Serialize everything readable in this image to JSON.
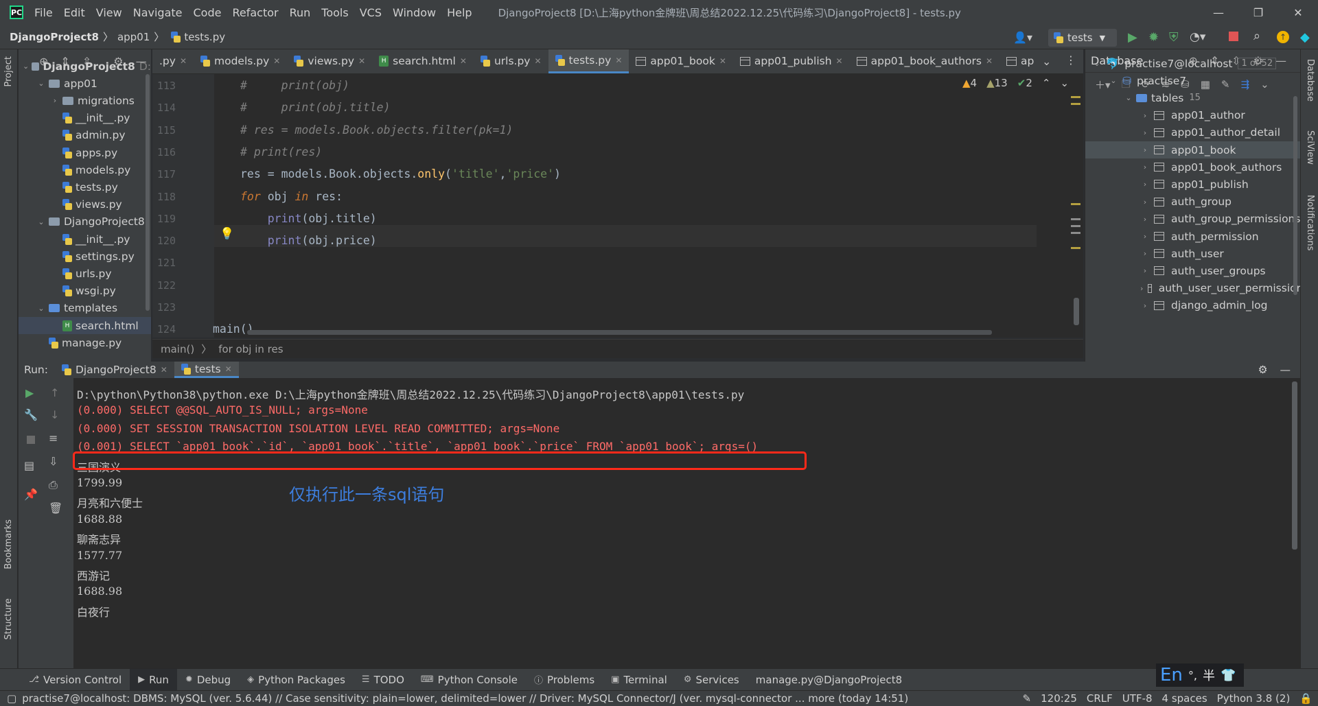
{
  "window": {
    "title": "DjangoProject8 [D:\\上海python金牌班\\周总结2022.12.25\\代码练习\\DjangoProject8] - tests.py",
    "menu": [
      "File",
      "Edit",
      "View",
      "Navigate",
      "Code",
      "Refactor",
      "Run",
      "Tools",
      "VCS",
      "Window",
      "Help"
    ]
  },
  "breadcrumb": [
    "DjangoProject8",
    "app01",
    "tests.py"
  ],
  "run_config": "tests",
  "project_tree": [
    {
      "label": "DjangoProject8",
      "extra": "D:",
      "type": "folder",
      "depth": 0,
      "open": true
    },
    {
      "label": "app01",
      "type": "folder",
      "depth": 1,
      "open": true
    },
    {
      "label": "migrations",
      "type": "folder",
      "depth": 2,
      "open": false
    },
    {
      "label": "__init__.py",
      "type": "py",
      "depth": 2
    },
    {
      "label": "admin.py",
      "type": "py",
      "depth": 2
    },
    {
      "label": "apps.py",
      "type": "py",
      "depth": 2
    },
    {
      "label": "models.py",
      "type": "py",
      "depth": 2
    },
    {
      "label": "tests.py",
      "type": "py",
      "depth": 2
    },
    {
      "label": "views.py",
      "type": "py",
      "depth": 2
    },
    {
      "label": "DjangoProject8",
      "type": "folder",
      "depth": 1,
      "open": true
    },
    {
      "label": "__init__.py",
      "type": "py",
      "depth": 2
    },
    {
      "label": "settings.py",
      "type": "py",
      "depth": 2
    },
    {
      "label": "urls.py",
      "type": "py",
      "depth": 2
    },
    {
      "label": "wsgi.py",
      "type": "py",
      "depth": 2
    },
    {
      "label": "templates",
      "type": "folder-blue",
      "depth": 1,
      "open": true
    },
    {
      "label": "search.html",
      "type": "html",
      "depth": 2,
      "selected": true
    },
    {
      "label": "manage.py",
      "type": "py",
      "depth": 1
    }
  ],
  "editor_tabs": [
    {
      "label": ".py",
      "type": "py",
      "partial": true
    },
    {
      "label": "models.py",
      "type": "py"
    },
    {
      "label": "views.py",
      "type": "py"
    },
    {
      "label": "search.html",
      "type": "html"
    },
    {
      "label": "urls.py",
      "type": "py"
    },
    {
      "label": "tests.py",
      "type": "py",
      "active": true
    },
    {
      "label": "app01_book",
      "type": "table"
    },
    {
      "label": "app01_publish",
      "type": "table"
    },
    {
      "label": "app01_book_authors",
      "type": "table"
    },
    {
      "label": "ap",
      "type": "table",
      "partial": true
    }
  ],
  "inspections": {
    "warnings": "4",
    "weak": "13",
    "ok": "2"
  },
  "code_lines": [
    {
      "n": "113",
      "html": "<span class='cm'>#     print(obj)</span>"
    },
    {
      "n": "114",
      "html": "<span class='cm'>#     print(obj.title)</span>"
    },
    {
      "n": "115",
      "html": "<span class='cm'># res = models.Book.objects.filter(pk=1)</span>"
    },
    {
      "n": "116",
      "html": "<span class='cm'># print(res)</span>"
    },
    {
      "n": "117",
      "html": "res = models.Book.objects.<span class='fn'>only</span>(<span class='str'>'title'</span>,<span class='str'>'price'</span>)"
    },
    {
      "n": "118",
      "html": "<span class='kw'>for</span> obj <span class='kw'>in</span> res:"
    },
    {
      "n": "119",
      "html": "    <span class='bi'>print</span>(obj.title)"
    },
    {
      "n": "120",
      "html": "    <span class='bi'>print</span>(obj.price)"
    },
    {
      "n": "121",
      "html": ""
    },
    {
      "n": "122",
      "html": ""
    },
    {
      "n": "123",
      "html": ""
    },
    {
      "n": "124",
      "html": "<span style='margin-left:-40px'>main()</span>"
    }
  ],
  "editor_breadcrumb": [
    "main()",
    "for obj in res"
  ],
  "database": {
    "title": "Database",
    "connection": "practise7@localhost",
    "connection_count": "1 of 52",
    "schema": "practise7",
    "tables_label": "tables",
    "tables_count": "15",
    "tables": [
      "app01_author",
      "app01_author_detail",
      "app01_book",
      "app01_book_authors",
      "app01_publish",
      "auth_group",
      "auth_group_permissions",
      "auth_permission",
      "auth_user",
      "auth_user_groups",
      "auth_user_user_permissior",
      "django_admin_log"
    ],
    "selected": "app01_book"
  },
  "run": {
    "label": "Run:",
    "tabs": [
      {
        "label": "DjangoProject8"
      },
      {
        "label": "tests",
        "active": true
      }
    ],
    "lines": [
      {
        "kind": "path",
        "text": "D:\\python\\Python38\\python.exe D:\\上海python金牌班\\周总结2022.12.25\\代码练习\\DjangoProject8\\app01\\tests.py"
      },
      {
        "kind": "sql",
        "text": "(0.000) SELECT @@SQL_AUTO_IS_NULL; args=None"
      },
      {
        "kind": "sql",
        "text": "(0.000) SET SESSION TRANSACTION ISOLATION LEVEL READ COMMITTED; args=None"
      },
      {
        "kind": "sql",
        "text": "(0.001) SELECT `app01_book`.`id`, `app01_book`.`title`, `app01_book`.`price` FROM `app01_book`; args=()"
      },
      {
        "kind": "out",
        "text": "三国演义"
      },
      {
        "kind": "out",
        "text": "1799.99"
      },
      {
        "kind": "out",
        "text": "月亮和六便士"
      },
      {
        "kind": "out",
        "text": "1688.88"
      },
      {
        "kind": "out",
        "text": "聊斋志异"
      },
      {
        "kind": "out",
        "text": "1577.77"
      },
      {
        "kind": "out",
        "text": "西游记"
      },
      {
        "kind": "out",
        "text": "1688.98"
      },
      {
        "kind": "out",
        "text": "白夜行"
      }
    ],
    "annotation": "仅执行此一条sql语句"
  },
  "tool_windows": [
    {
      "label": "Version Control"
    },
    {
      "label": "Run",
      "active": true
    },
    {
      "label": "Debug"
    },
    {
      "label": "Python Packages"
    },
    {
      "label": "TODO"
    },
    {
      "label": "Python Console"
    },
    {
      "label": "Problems"
    },
    {
      "label": "Terminal"
    },
    {
      "label": "Services"
    },
    {
      "label": "manage.py@DjangoProject8"
    }
  ],
  "status": {
    "message": "practise7@localhost: DBMS: MySQL (ver. 5.6.44) // Case sensitivity: plain=lower, delimited=lower // Driver: MySQL Connector/J (ver. mysql-connector ... more (today 14:51)",
    "position": "120:25",
    "line_sep": "CRLF",
    "encoding": "UTF-8",
    "indent": "4 spaces",
    "interpreter": "Python 3.8 (2)"
  },
  "ime": {
    "lang": "En",
    "punct": "°,",
    "width": "半"
  },
  "side_labels": {
    "project": "Project",
    "bookmarks": "Bookmarks",
    "structure": "Structure",
    "database": "Database",
    "sciview": "SciView",
    "notifications": "Notifications"
  },
  "colors": {
    "accent": "#4a88c7",
    "highlight_box": "#ff2a1a",
    "annotation": "#3d7ede",
    "sql": "#ff6b68",
    "run": "#59a869",
    "stop": "#e05555"
  }
}
